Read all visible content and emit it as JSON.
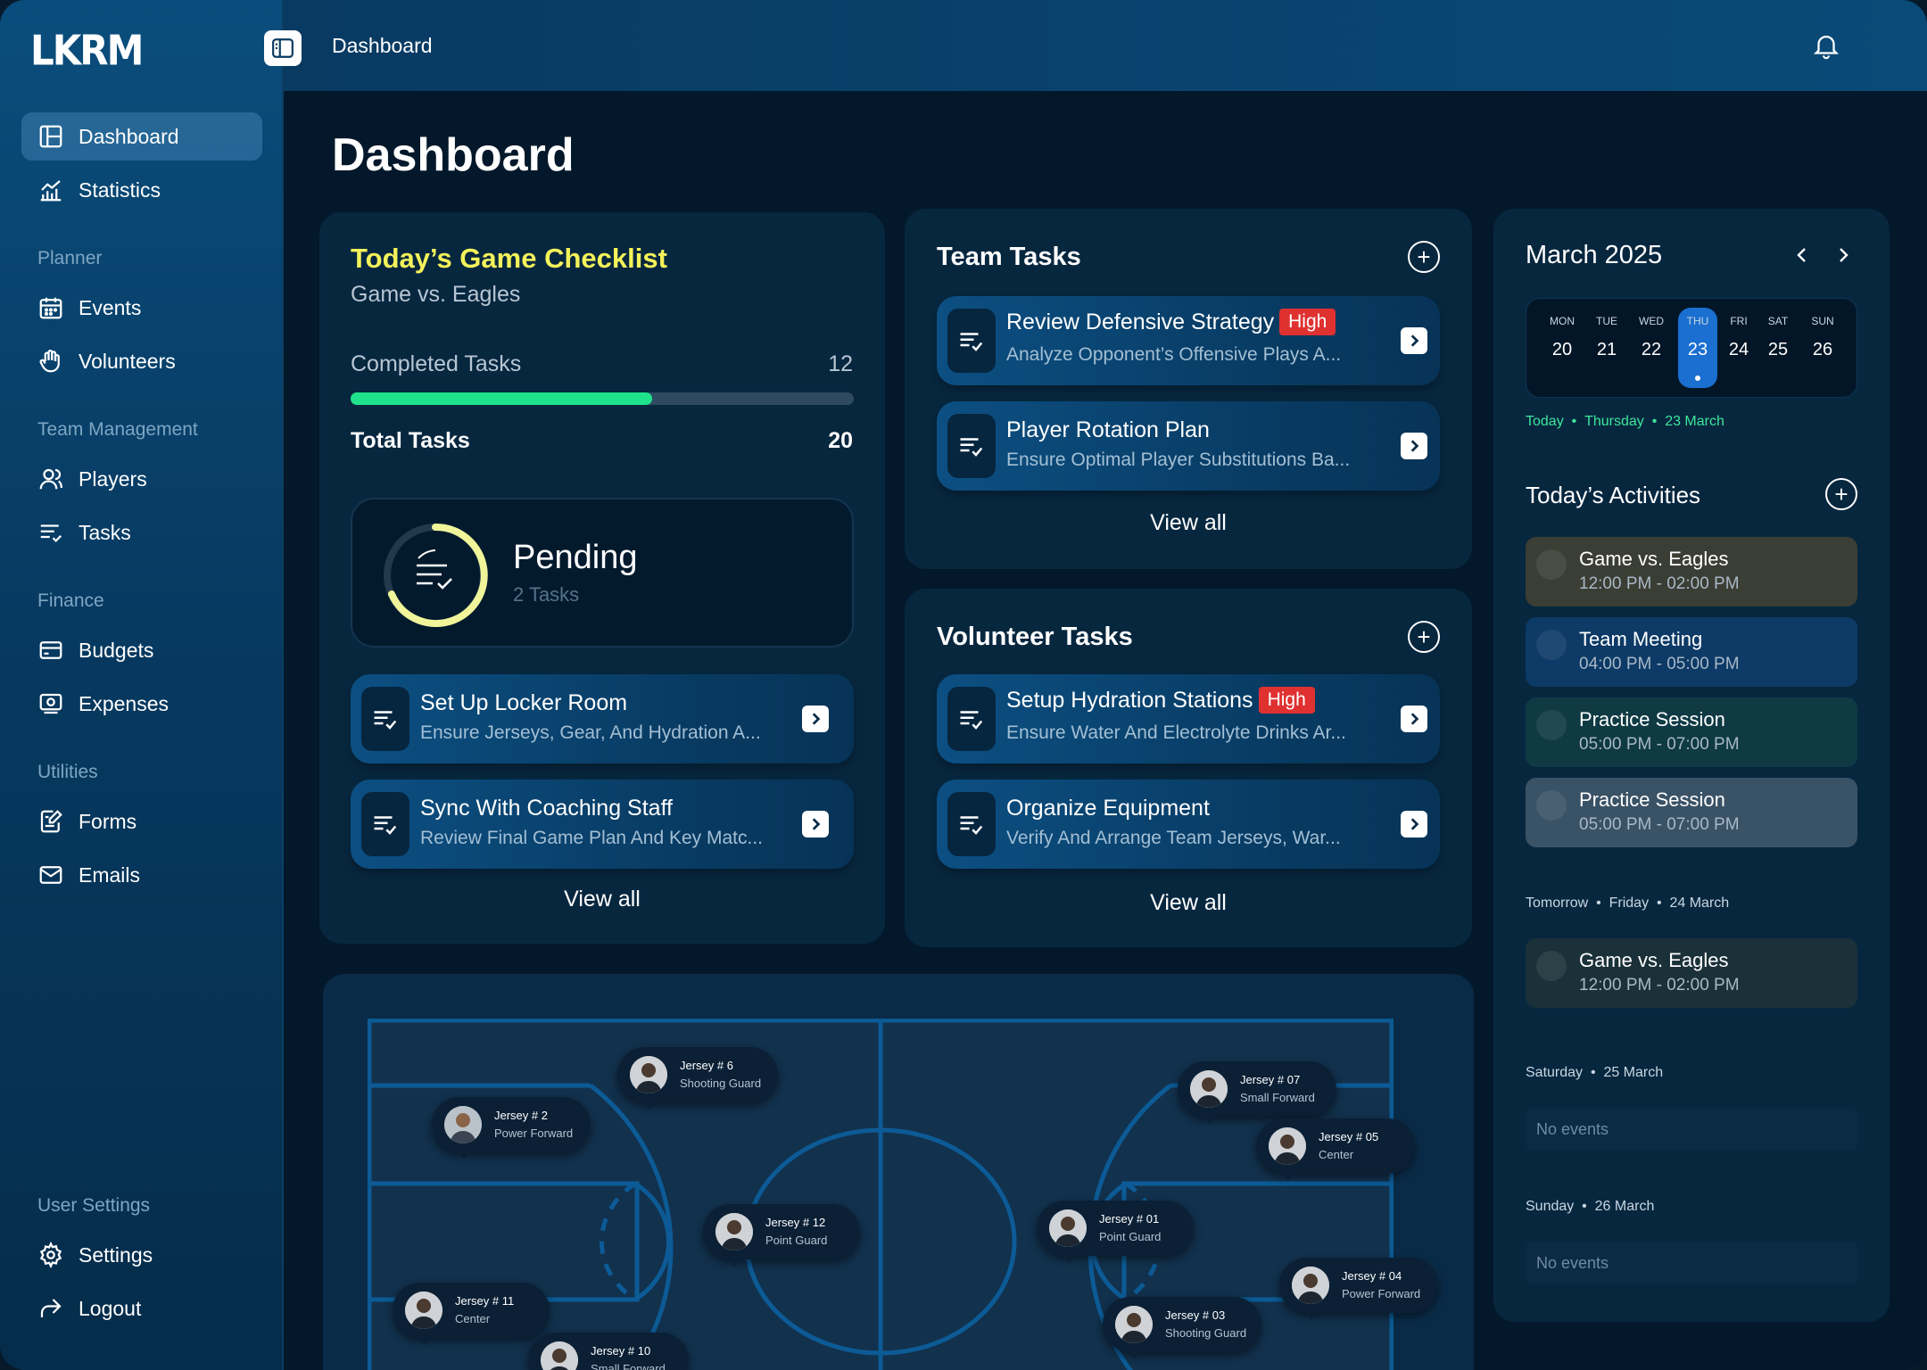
{
  "app": {
    "logo": "LKRM"
  },
  "topbar": {
    "breadcrumb": "Dashboard"
  },
  "page": {
    "title": "Dashboard"
  },
  "sidebar": {
    "items_top": [
      {
        "label": "Dashboard",
        "icon": "layout-icon",
        "active": true
      },
      {
        "label": "Statistics",
        "icon": "chart-icon"
      }
    ],
    "sections": [
      {
        "title": "Planner",
        "items": [
          {
            "label": "Events",
            "icon": "calendar-icon"
          },
          {
            "label": "Volunteers",
            "icon": "hand-icon"
          }
        ]
      },
      {
        "title": "Team Management",
        "items": [
          {
            "label": "Players",
            "icon": "user-icon"
          },
          {
            "label": "Tasks",
            "icon": "tasks-icon"
          }
        ]
      },
      {
        "title": "Finance",
        "items": [
          {
            "label": "Budgets",
            "icon": "wallet-icon"
          },
          {
            "label": "Expenses",
            "icon": "cash-icon"
          }
        ]
      },
      {
        "title": "Utilities",
        "items": [
          {
            "label": "Forms",
            "icon": "form-icon"
          },
          {
            "label": "Emails",
            "icon": "mail-icon"
          }
        ]
      }
    ],
    "user_settings": {
      "title": "User Settings",
      "items": [
        {
          "label": "Settings",
          "icon": "gear-icon"
        },
        {
          "label": "Logout",
          "icon": "logout-icon"
        }
      ]
    }
  },
  "checklist": {
    "title": "Today’s Game Checklist",
    "subtitle": "Game vs. Eagles",
    "completed_label": "Completed Tasks",
    "completed_value": "12",
    "progress": 0.6,
    "total_label": "Total Tasks",
    "total_value": "20",
    "pending_label": "Pending",
    "pending_count": "2 Tasks",
    "tasks": [
      {
        "title": "Set Up Locker Room",
        "subtitle": "Ensure Jerseys, Gear, And Hydration A..."
      },
      {
        "title": "Sync With Coaching Staff",
        "subtitle": "Review Final Game Plan And Key Matc..."
      }
    ],
    "view_all": "View all"
  },
  "team_tasks": {
    "title": "Team Tasks",
    "tasks": [
      {
        "title": "Review Defensive Strategy",
        "badge": "High",
        "subtitle": "Analyze Opponent’s Offensive Plays A..."
      },
      {
        "title": "Player Rotation Plan",
        "subtitle": "Ensure Optimal Player Substitutions Ba..."
      }
    ],
    "view_all": "View all"
  },
  "volunteer_tasks": {
    "title": "Volunteer Tasks",
    "tasks": [
      {
        "title": "Setup Hydration Stations",
        "badge": "High",
        "subtitle": "Ensure Water And Electrolyte Drinks Ar..."
      },
      {
        "title": "Organize Equipment",
        "subtitle": "Verify And Arrange Team Jerseys, War..."
      }
    ],
    "view_all": "View all"
  },
  "calendar": {
    "month": "March 2025",
    "days": [
      {
        "name": "MON",
        "date": "20"
      },
      {
        "name": "TUE",
        "date": "21"
      },
      {
        "name": "WED",
        "date": "22"
      },
      {
        "name": "THU",
        "date": "23",
        "selected": true
      },
      {
        "name": "FRI",
        "date": "24"
      },
      {
        "name": "SAT",
        "date": "25"
      },
      {
        "name": "SUN",
        "date": "26"
      }
    ],
    "today_line": {
      "a": "Today",
      "b": "Thursday",
      "c": "23 March"
    }
  },
  "activities": {
    "title": "Today’s Activities",
    "today": [
      {
        "title": "Game vs. Eagles",
        "time": "12:00 PM - 02:00 PM",
        "color": "#3b3e34"
      },
      {
        "title": "Team Meeting",
        "time": "04:00 PM - 05:00 PM",
        "color": "#0d3a66"
      },
      {
        "title": "Practice Session",
        "time": "05:00 PM - 07:00 PM",
        "color": "#0f3a44"
      },
      {
        "title": "Practice Session",
        "time": "05:00 PM - 07:00 PM",
        "color": "#3a5266"
      }
    ],
    "tomorrow_head": {
      "a": "Tomorrow",
      "b": "Friday",
      "c": "24 March"
    },
    "tomorrow": [
      {
        "title": "Game vs. Eagles",
        "time": "12:00 PM - 02:00 PM",
        "color": "#1b3139"
      }
    ],
    "saturday_head": {
      "a": "Saturday",
      "b": "25 March"
    },
    "saturday_empty": "No events",
    "sunday_head": {
      "a": "Sunday",
      "b": "26 March"
    },
    "sunday_empty": "No events"
  },
  "court": {
    "players": [
      {
        "jersey": "Jersey # 6",
        "position": "Shooting Guard"
      },
      {
        "jersey": "Jersey # 2",
        "position": "Power Forward"
      },
      {
        "jersey": "Jersey # 12",
        "position": "Point Guard"
      },
      {
        "jersey": "Jersey # 11",
        "position": "Center"
      },
      {
        "jersey": "Jersey # 10",
        "position": "Small Forward"
      },
      {
        "jersey": "Jersey # 07",
        "position": "Small Forward"
      },
      {
        "jersey": "Jersey # 05",
        "position": "Center"
      },
      {
        "jersey": "Jersey # 01",
        "position": "Point Guard"
      },
      {
        "jersey": "Jersey # 04",
        "position": "Power Forward"
      },
      {
        "jersey": "Jersey # 03",
        "position": "Shooting Guard"
      }
    ]
  },
  "colors": {
    "accent_green": "#1fe38b",
    "checklist_title": "#f4f25a",
    "high_badge": "#e03131",
    "selected_day": "#1a6fd0"
  }
}
